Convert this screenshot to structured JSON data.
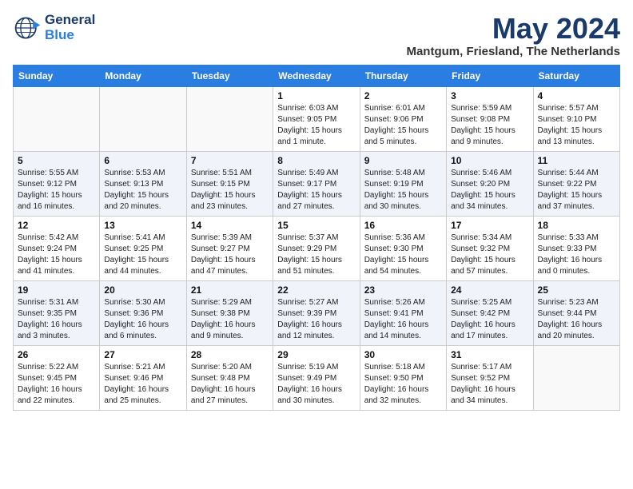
{
  "header": {
    "logo_line1": "General",
    "logo_line2": "Blue",
    "title": "May 2024",
    "subtitle": "Mantgum, Friesland, The Netherlands"
  },
  "days_of_week": [
    "Sunday",
    "Monday",
    "Tuesday",
    "Wednesday",
    "Thursday",
    "Friday",
    "Saturday"
  ],
  "weeks": [
    [
      {
        "day": "",
        "info": ""
      },
      {
        "day": "",
        "info": ""
      },
      {
        "day": "",
        "info": ""
      },
      {
        "day": "1",
        "info": "Sunrise: 6:03 AM\nSunset: 9:05 PM\nDaylight: 15 hours\nand 1 minute."
      },
      {
        "day": "2",
        "info": "Sunrise: 6:01 AM\nSunset: 9:06 PM\nDaylight: 15 hours\nand 5 minutes."
      },
      {
        "day": "3",
        "info": "Sunrise: 5:59 AM\nSunset: 9:08 PM\nDaylight: 15 hours\nand 9 minutes."
      },
      {
        "day": "4",
        "info": "Sunrise: 5:57 AM\nSunset: 9:10 PM\nDaylight: 15 hours\nand 13 minutes."
      }
    ],
    [
      {
        "day": "5",
        "info": "Sunrise: 5:55 AM\nSunset: 9:12 PM\nDaylight: 15 hours\nand 16 minutes."
      },
      {
        "day": "6",
        "info": "Sunrise: 5:53 AM\nSunset: 9:13 PM\nDaylight: 15 hours\nand 20 minutes."
      },
      {
        "day": "7",
        "info": "Sunrise: 5:51 AM\nSunset: 9:15 PM\nDaylight: 15 hours\nand 23 minutes."
      },
      {
        "day": "8",
        "info": "Sunrise: 5:49 AM\nSunset: 9:17 PM\nDaylight: 15 hours\nand 27 minutes."
      },
      {
        "day": "9",
        "info": "Sunrise: 5:48 AM\nSunset: 9:19 PM\nDaylight: 15 hours\nand 30 minutes."
      },
      {
        "day": "10",
        "info": "Sunrise: 5:46 AM\nSunset: 9:20 PM\nDaylight: 15 hours\nand 34 minutes."
      },
      {
        "day": "11",
        "info": "Sunrise: 5:44 AM\nSunset: 9:22 PM\nDaylight: 15 hours\nand 37 minutes."
      }
    ],
    [
      {
        "day": "12",
        "info": "Sunrise: 5:42 AM\nSunset: 9:24 PM\nDaylight: 15 hours\nand 41 minutes."
      },
      {
        "day": "13",
        "info": "Sunrise: 5:41 AM\nSunset: 9:25 PM\nDaylight: 15 hours\nand 44 minutes."
      },
      {
        "day": "14",
        "info": "Sunrise: 5:39 AM\nSunset: 9:27 PM\nDaylight: 15 hours\nand 47 minutes."
      },
      {
        "day": "15",
        "info": "Sunrise: 5:37 AM\nSunset: 9:29 PM\nDaylight: 15 hours\nand 51 minutes."
      },
      {
        "day": "16",
        "info": "Sunrise: 5:36 AM\nSunset: 9:30 PM\nDaylight: 15 hours\nand 54 minutes."
      },
      {
        "day": "17",
        "info": "Sunrise: 5:34 AM\nSunset: 9:32 PM\nDaylight: 15 hours\nand 57 minutes."
      },
      {
        "day": "18",
        "info": "Sunrise: 5:33 AM\nSunset: 9:33 PM\nDaylight: 16 hours\nand 0 minutes."
      }
    ],
    [
      {
        "day": "19",
        "info": "Sunrise: 5:31 AM\nSunset: 9:35 PM\nDaylight: 16 hours\nand 3 minutes."
      },
      {
        "day": "20",
        "info": "Sunrise: 5:30 AM\nSunset: 9:36 PM\nDaylight: 16 hours\nand 6 minutes."
      },
      {
        "day": "21",
        "info": "Sunrise: 5:29 AM\nSunset: 9:38 PM\nDaylight: 16 hours\nand 9 minutes."
      },
      {
        "day": "22",
        "info": "Sunrise: 5:27 AM\nSunset: 9:39 PM\nDaylight: 16 hours\nand 12 minutes."
      },
      {
        "day": "23",
        "info": "Sunrise: 5:26 AM\nSunset: 9:41 PM\nDaylight: 16 hours\nand 14 minutes."
      },
      {
        "day": "24",
        "info": "Sunrise: 5:25 AM\nSunset: 9:42 PM\nDaylight: 16 hours\nand 17 minutes."
      },
      {
        "day": "25",
        "info": "Sunrise: 5:23 AM\nSunset: 9:44 PM\nDaylight: 16 hours\nand 20 minutes."
      }
    ],
    [
      {
        "day": "26",
        "info": "Sunrise: 5:22 AM\nSunset: 9:45 PM\nDaylight: 16 hours\nand 22 minutes."
      },
      {
        "day": "27",
        "info": "Sunrise: 5:21 AM\nSunset: 9:46 PM\nDaylight: 16 hours\nand 25 minutes."
      },
      {
        "day": "28",
        "info": "Sunrise: 5:20 AM\nSunset: 9:48 PM\nDaylight: 16 hours\nand 27 minutes."
      },
      {
        "day": "29",
        "info": "Sunrise: 5:19 AM\nSunset: 9:49 PM\nDaylight: 16 hours\nand 30 minutes."
      },
      {
        "day": "30",
        "info": "Sunrise: 5:18 AM\nSunset: 9:50 PM\nDaylight: 16 hours\nand 32 minutes."
      },
      {
        "day": "31",
        "info": "Sunrise: 5:17 AM\nSunset: 9:52 PM\nDaylight: 16 hours\nand 34 minutes."
      },
      {
        "day": "",
        "info": ""
      }
    ]
  ]
}
